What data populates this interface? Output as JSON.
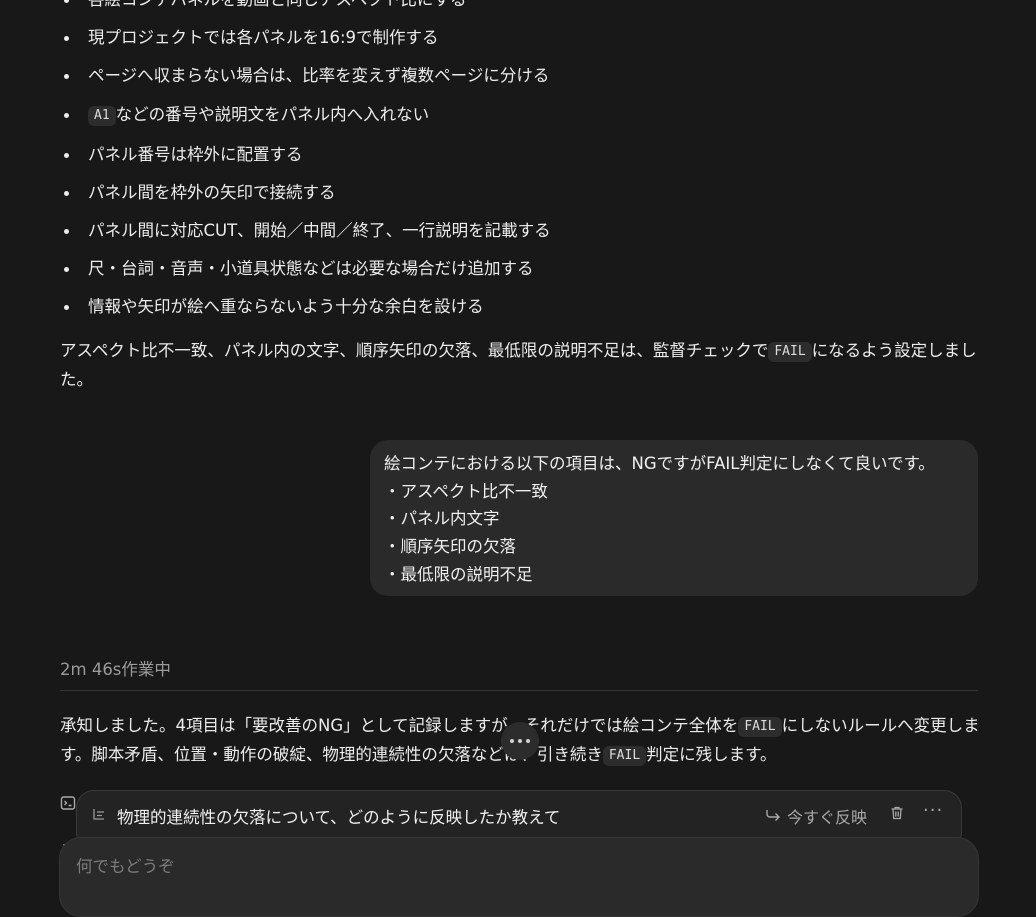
{
  "assistant_prev": {
    "bullets": [
      {
        "text": "各絵コンテパネルを動画と同じアスペクト比にする"
      },
      {
        "text": "現プロジェクトでは各パネルを16:9で制作する"
      },
      {
        "text": "ページへ収まらない場合は、比率を変えず複数ページに分ける"
      },
      {
        "code": "A1",
        "text": "などの番号や説明文をパネル内へ入れない"
      },
      {
        "text": "パネル番号は枠外に配置する"
      },
      {
        "text": "パネル間を枠外の矢印で接続する"
      },
      {
        "text": "パネル間に対応CUT、開始／中間／終了、一行説明を記載する"
      },
      {
        "text": "尺・台詞・音声・小道具状態などは必要な場合だけ追加する"
      },
      {
        "text": "情報や矢印が絵へ重ならないよう十分な余白を設ける"
      }
    ],
    "summary_before": "アスペクト比不一致、パネル内の文字、順序矢印の欠落、最低限の説明不足は、監督チェックで",
    "summary_code": "FAIL",
    "summary_after": "になるよう設定しました。"
  },
  "user_message": {
    "lines": [
      "絵コンテにおける以下の項目は、NGですがFAIL判定にしなくて良いです。",
      "・アスペクト比不一致",
      "・パネル内文字",
      "・順序矢印の欠落",
      "・最低限の説明不足"
    ]
  },
  "worked_label": "2m 46s作業中",
  "assistant_reply": {
    "p1": "承知しました。4項目は「要改善のNG」として記録しますが、それだけでは絵コンテ全体を",
    "code1": "FAIL",
    "p2": "にしないルールへ変更します。脚本矛盾、位置・動作の破綻、物理的連続性の欠落などは、引き続き",
    "code2": "FAIL",
    "p3": "判定に残します。"
  },
  "queued": {
    "text": "物理的連続性の欠落について、どのように反映したか教えて",
    "apply_label": "今すぐ反映",
    "icons": [
      "queue-icon",
      "reply-arrow-icon",
      "trash-icon",
      "more-icon"
    ]
  },
  "composer": {
    "placeholder": "何でもどうぞ"
  }
}
